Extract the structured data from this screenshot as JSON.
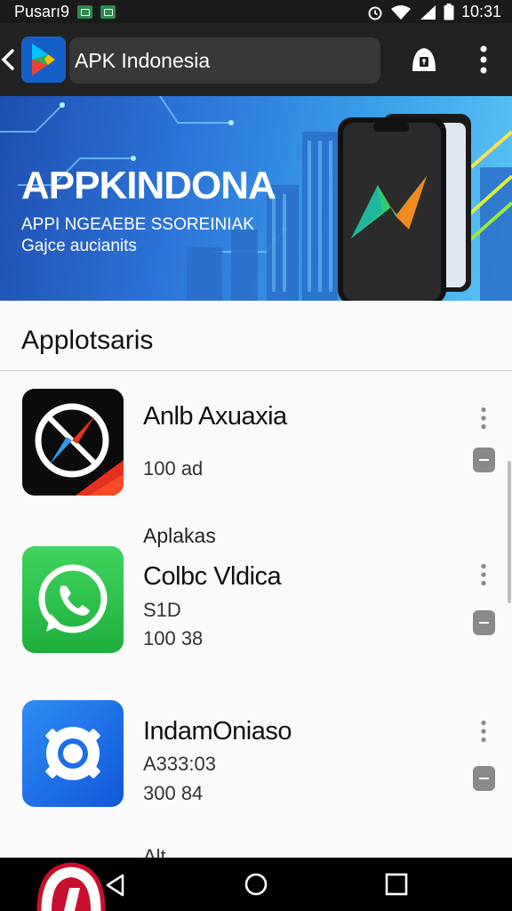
{
  "status_bar": {
    "carrier": "Pusarı9",
    "time": "10:31",
    "icons": [
      "notification-icon",
      "notification-icon",
      "alarm-icon",
      "wifi-icon",
      "signal-icon",
      "battery-icon"
    ]
  },
  "app_bar": {
    "search_text": "APK Indonesia",
    "icons": [
      "back-icon",
      "play-store-logo",
      "account-icon",
      "more-vert-icon"
    ]
  },
  "banner": {
    "title": "APPKINDONA",
    "subtitle_line1": "APPI NGEAEBE SSOREINIAK",
    "subtitle_line2": "Gajce aucianits"
  },
  "section": {
    "title": "Applotsaris"
  },
  "apps": [
    {
      "name": "Anlb Axuaxia",
      "meta": "100 ad",
      "icon": "compass-app-icon"
    },
    {
      "category": "Aplakas",
      "name": "Colbc Vldica",
      "meta1": "S1D",
      "meta2": "100 38",
      "icon": "whatsapp-icon"
    },
    {
      "name": "IndamOniaso",
      "meta1": "A333:03",
      "meta2": "300 84",
      "icon": "circle-app-icon"
    }
  ],
  "partial_row_text": "Alt",
  "colors": {
    "status_bar": "#1b1b1b",
    "app_bar": "#222222",
    "banner_start": "#1f4fb0",
    "banner_end": "#5cc4f5",
    "whatsapp_green": "#25c24a",
    "app3_blue": "#1e6fe6"
  },
  "nav_bar": {
    "icons": [
      "nav-back-icon",
      "nav-home-icon",
      "nav-recents-icon"
    ]
  }
}
